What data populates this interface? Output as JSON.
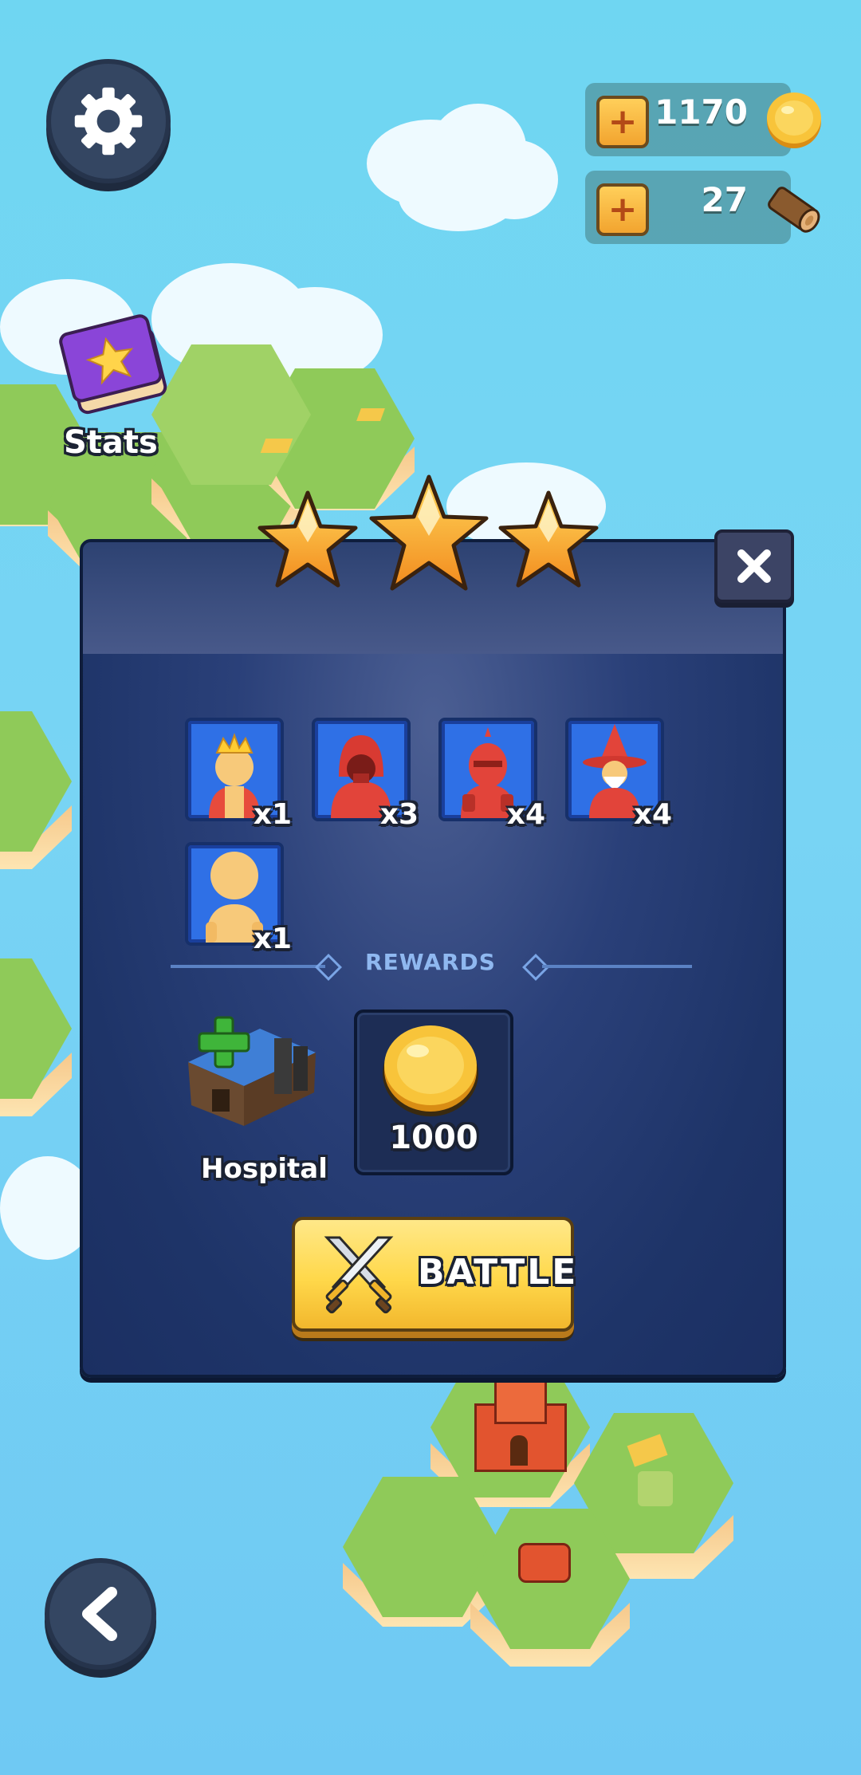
{
  "hud": {
    "coins": "1170",
    "wood": "27",
    "stats_label": "Stats"
  },
  "stars": {
    "earned": 3,
    "total": 3
  },
  "units": [
    {
      "name": "king",
      "count": "x1",
      "color": "#e74b3c"
    },
    {
      "name": "hooded-warrior",
      "count": "x3",
      "color": "#e2443a"
    },
    {
      "name": "knight",
      "count": "x4",
      "color": "#e2443a"
    },
    {
      "name": "wizard",
      "count": "x4",
      "color": "#e2443a"
    },
    {
      "name": "peasant",
      "count": "x1",
      "color": "#f7c97a"
    }
  ],
  "rewards": {
    "heading": "REWARDS",
    "building_label": "Hospital",
    "coin_amount": "1000"
  },
  "battle": {
    "label": "BATTLE"
  },
  "colors": {
    "panel": "#1e3468",
    "card": "#2f70e6",
    "button": "#ffd84a",
    "coin": "#f8c43a",
    "star": "#f6a12c"
  }
}
